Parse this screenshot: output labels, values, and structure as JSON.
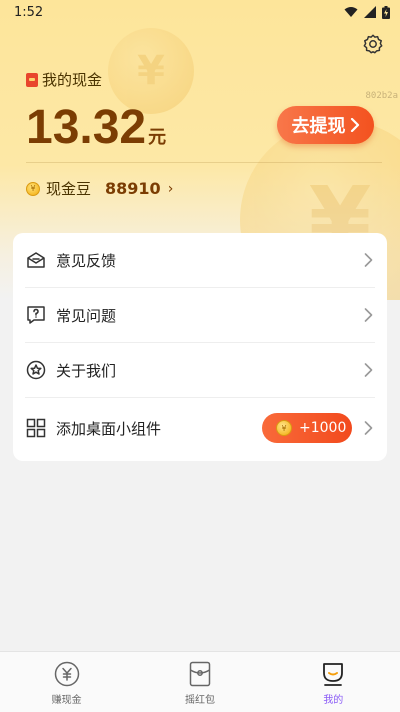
{
  "status_bar": {
    "time": "1:52"
  },
  "header": {
    "debug_id": "802b2a",
    "cash_label": "我的现金",
    "cash_amount": "13.32",
    "cash_unit": "元",
    "withdraw_label": "去提现",
    "bean_label": "现金豆",
    "bean_value": "88910",
    "accent_color": "#f3521f"
  },
  "menu": {
    "items": [
      {
        "label": "意见反馈",
        "icon": "feedback-envelope-icon"
      },
      {
        "label": "常见问题",
        "icon": "question-bubble-icon"
      },
      {
        "label": "关于我们",
        "icon": "star-circle-icon"
      },
      {
        "label": "添加桌面小组件",
        "icon": "widget-grid-icon"
      }
    ],
    "widget_bonus": "+1000"
  },
  "bottom_nav": {
    "items": [
      {
        "label": "赚现金",
        "icon": "yuan-coin-icon"
      },
      {
        "label": "摇红包",
        "icon": "red-packet-icon"
      },
      {
        "label": "我的",
        "icon": "profile-cup-icon",
        "active": true
      }
    ],
    "active_color": "#8b5cf6"
  }
}
